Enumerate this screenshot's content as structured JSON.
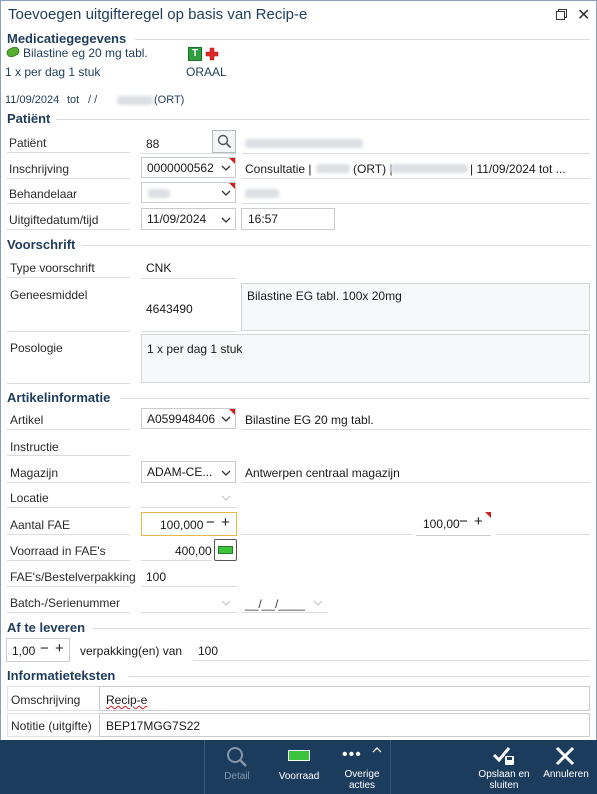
{
  "window": {
    "title": "Toevoegen uitgifteregel op basis van Recip-e"
  },
  "medicatie": {
    "section_title": "Medicatiegegevens",
    "drug_name": "Bilastine eg 20 mg tabl.",
    "dosage": "1 x per dag 1 stuk",
    "badge_letter": "T",
    "route": "ORAAL",
    "period_start": "11/09/2024",
    "period_tot": "tot",
    "period_end": "/ /",
    "prescriber_suffix": "(ORT)"
  },
  "patient": {
    "section_title": "Patiënt",
    "patient_label": "Patiënt",
    "patient_value": "88",
    "inschrijving_label": "Inschrijving",
    "inschrijving_value": "0000000562",
    "consult_text": "Consultatie |",
    "consult_ort": "(ORT) |",
    "consult_tail": "| 11/09/2024 tot ...",
    "behandelaar_label": "Behandelaar",
    "uitgifte_label": "Uitgiftedatum/tijd",
    "uitgifte_date": "11/09/2024",
    "uitgifte_time": "16:57"
  },
  "voorschrift": {
    "section_title": "Voorschrift",
    "type_label": "Type voorschrift",
    "type_value": "CNK",
    "geneesmiddel_label": "Geneesmiddel",
    "geneesmiddel_code": "4643490",
    "geneesmiddel_desc": "Bilastine EG tabl. 100x 20mg",
    "posologie_label": "Posologie",
    "posologie_value": "1 x per dag 1 stuk"
  },
  "artikel": {
    "section_title": "Artikelinformatie",
    "artikel_label": "Artikel",
    "artikel_code": "A059948406",
    "artikel_desc": "Bilastine EG 20 mg tabl.",
    "instructie_label": "Instructie",
    "magazijn_label": "Magazijn",
    "magazijn_code": "ADAM-CE...",
    "magazijn_desc": "Antwerpen centraal magazijn",
    "locatie_label": "Locatie",
    "aantal_label": "Aantal FAE",
    "aantal_value": "100,000",
    "aantal_value2": "100,00",
    "voorraad_label": "Voorraad in FAE's",
    "voorraad_value": "400,00",
    "fae_label": "FAE's/Bestelverpakking",
    "fae_value": "100",
    "batch_label": "Batch-/Serienummer",
    "batch_date": "__/__/____"
  },
  "leveren": {
    "section_title": "Af te leveren",
    "qty": "1,00",
    "verpakking_text": "verpakking(en) van",
    "verpakking_value": "100"
  },
  "info": {
    "section_title": "Informatieteksten",
    "omschrijving_label": "Omschrijving",
    "omschrijving_value": "Recip-e",
    "notitie_label": "Notitie (uitgifte)",
    "notitie_value": "BEP17MGG7S22"
  },
  "toolbar": {
    "detail": "Detail",
    "voorraad": "Voorraad",
    "overige_1": "Overige",
    "overige_2": "acties",
    "opslaan_1": "Opslaan en",
    "opslaan_2": "sluiten",
    "annuleren": "Annuleren"
  },
  "colors": {
    "accent": "#1e3c5a",
    "toolbar": "#1c3c5e",
    "status_green": "#3cc43c",
    "required": "#d02020"
  }
}
